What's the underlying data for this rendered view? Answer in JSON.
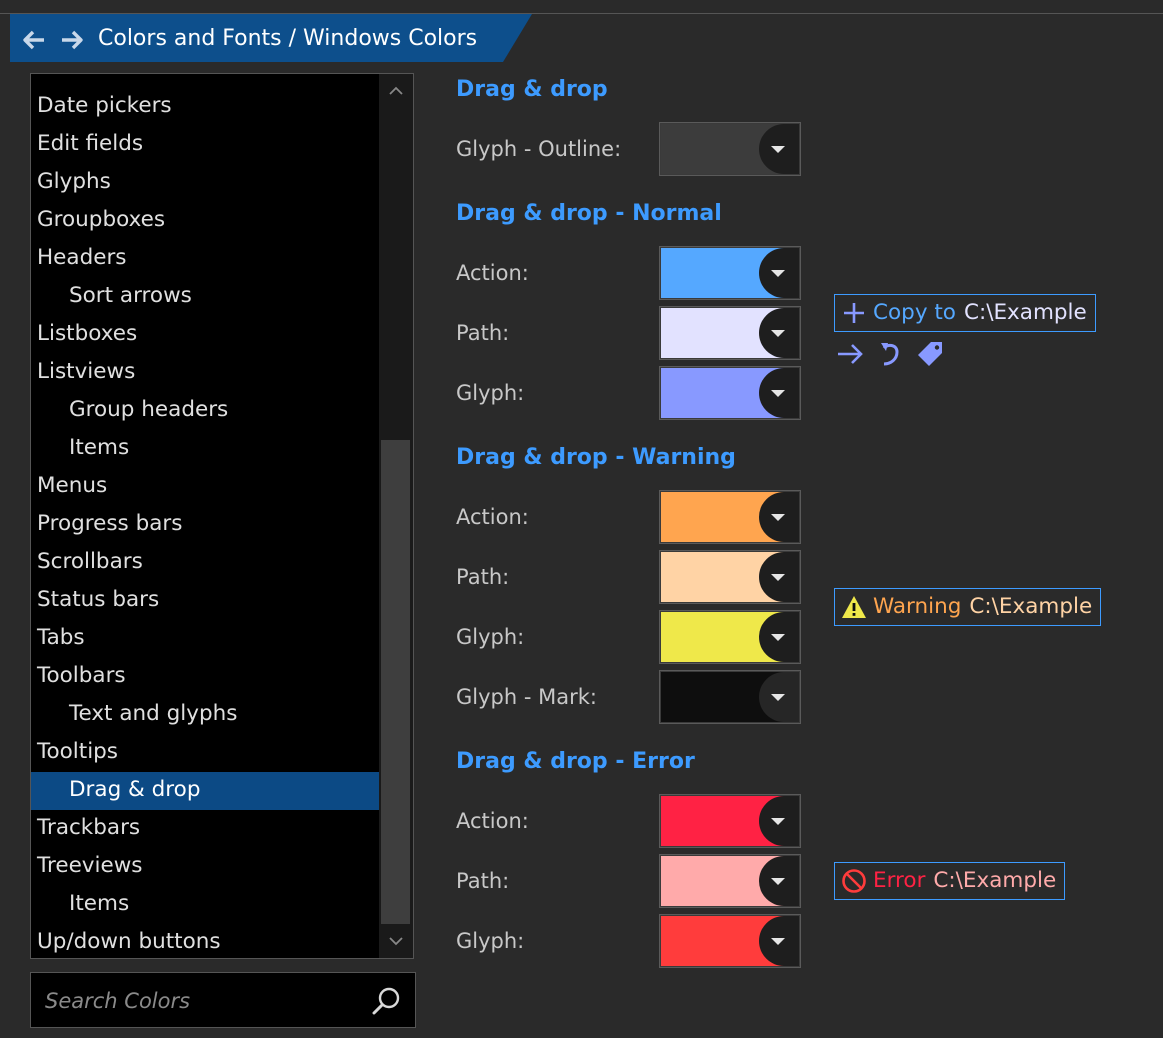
{
  "header": {
    "breadcrumb": "Colors and Fonts / Windows Colors",
    "tab_color": "#0d4f8c"
  },
  "sidebar": {
    "items": [
      {
        "label": "Date pickers",
        "sub": false,
        "selected": false
      },
      {
        "label": "Edit fields",
        "sub": false,
        "selected": false
      },
      {
        "label": "Glyphs",
        "sub": false,
        "selected": false
      },
      {
        "label": "Groupboxes",
        "sub": false,
        "selected": false
      },
      {
        "label": "Headers",
        "sub": false,
        "selected": false
      },
      {
        "label": "Sort arrows",
        "sub": true,
        "selected": false
      },
      {
        "label": "Listboxes",
        "sub": false,
        "selected": false
      },
      {
        "label": "Listviews",
        "sub": false,
        "selected": false
      },
      {
        "label": "Group headers",
        "sub": true,
        "selected": false
      },
      {
        "label": "Items",
        "sub": true,
        "selected": false
      },
      {
        "label": "Menus",
        "sub": false,
        "selected": false
      },
      {
        "label": "Progress bars",
        "sub": false,
        "selected": false
      },
      {
        "label": "Scrollbars",
        "sub": false,
        "selected": false
      },
      {
        "label": "Status bars",
        "sub": false,
        "selected": false
      },
      {
        "label": "Tabs",
        "sub": false,
        "selected": false
      },
      {
        "label": "Toolbars",
        "sub": false,
        "selected": false
      },
      {
        "label": "Text and glyphs",
        "sub": true,
        "selected": false
      },
      {
        "label": "Tooltips",
        "sub": false,
        "selected": false
      },
      {
        "label": "Drag & drop",
        "sub": true,
        "selected": true
      },
      {
        "label": "Trackbars",
        "sub": false,
        "selected": false
      },
      {
        "label": "Treeviews",
        "sub": false,
        "selected": false
      },
      {
        "label": "Items",
        "sub": true,
        "selected": false
      },
      {
        "label": "Up/down buttons",
        "sub": false,
        "selected": false
      }
    ]
  },
  "search": {
    "placeholder": "Search Colors"
  },
  "sections": {
    "dragdrop": {
      "title": "Drag & drop",
      "outline_label": "Glyph - Outline:",
      "outline_color": "#3c3c3c"
    },
    "normal": {
      "title": "Drag & drop - Normal",
      "action_label": "Action:",
      "action_color": "#55a8ff",
      "path_label": "Path:",
      "path_color": "#e2e2ff",
      "glyph_label": "Glyph:",
      "glyph_color": "#8899ff"
    },
    "warning": {
      "title": "Drag & drop - Warning",
      "action_label": "Action:",
      "action_color": "#ffa54f",
      "path_label": "Path:",
      "path_color": "#ffd3a5",
      "glyph_label": "Glyph:",
      "glyph_color": "#efe84a",
      "mark_label": "Glyph - Mark:",
      "mark_color": "#0e0e0e"
    },
    "error": {
      "title": "Drag & drop - Error",
      "action_label": "Action:",
      "action_color": "#ff2244",
      "path_label": "Path:",
      "path_color": "#ffaaaa",
      "glyph_label": "Glyph:",
      "glyph_color": "#ff3c3c"
    }
  },
  "previews": {
    "normal": {
      "action": "Copy to",
      "path": "C:\\Example",
      "icon": "plus-icon"
    },
    "normal_glyphs": [
      "arrow-right-icon",
      "redirect-icon",
      "tag-icon"
    ],
    "warning": {
      "action": "Warning",
      "path": "C:\\Example",
      "icon": "warning-icon"
    },
    "error": {
      "action": "Error",
      "path": "C:\\Example",
      "icon": "no-entry-icon"
    }
  }
}
